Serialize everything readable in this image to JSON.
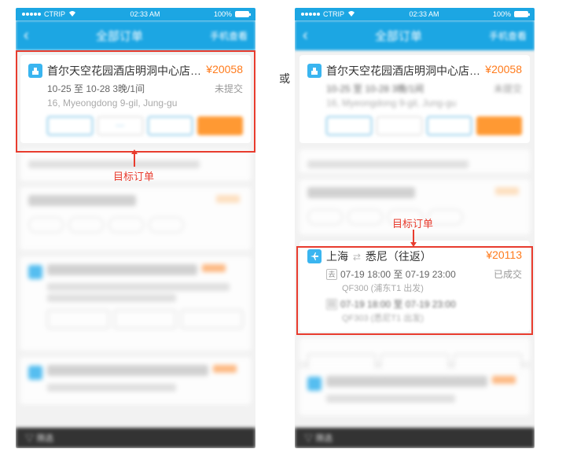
{
  "status_bar": {
    "carrier": "CTRIP",
    "time": "02:33 AM",
    "battery": "100%"
  },
  "header": {
    "title": "全部订单",
    "right": "手机查看"
  },
  "hotel_card": {
    "title": "首尔天空花园酒店明洞中心店 (H...",
    "price": "¥20058",
    "date_line": "10-25  至  10-28   3晚/1间",
    "status": "未提交",
    "address": "16, Myeongdong 9-gil, Jung-gu",
    "actions": {
      "a1": " ",
      "a2": "···",
      "a3": " ",
      "a4": " "
    }
  },
  "flight_card": {
    "from": "上海",
    "to": "悉尼（往返）",
    "price": "¥20113",
    "status": "已成交",
    "out_icon": "去",
    "out_line": "07-19 18:00  至  07-19 23:00",
    "out_code": "QF300 (浦东T1 出发)",
    "ret_icon": "回",
    "ret_line": "07-19 18:00  至  07-19 23:00",
    "ret_code": "QF303 (悉尼T1 出发)"
  },
  "annotation": {
    "label": "目标订单",
    "or": "或"
  },
  "bottom_bar": {
    "filter": "筛选"
  }
}
